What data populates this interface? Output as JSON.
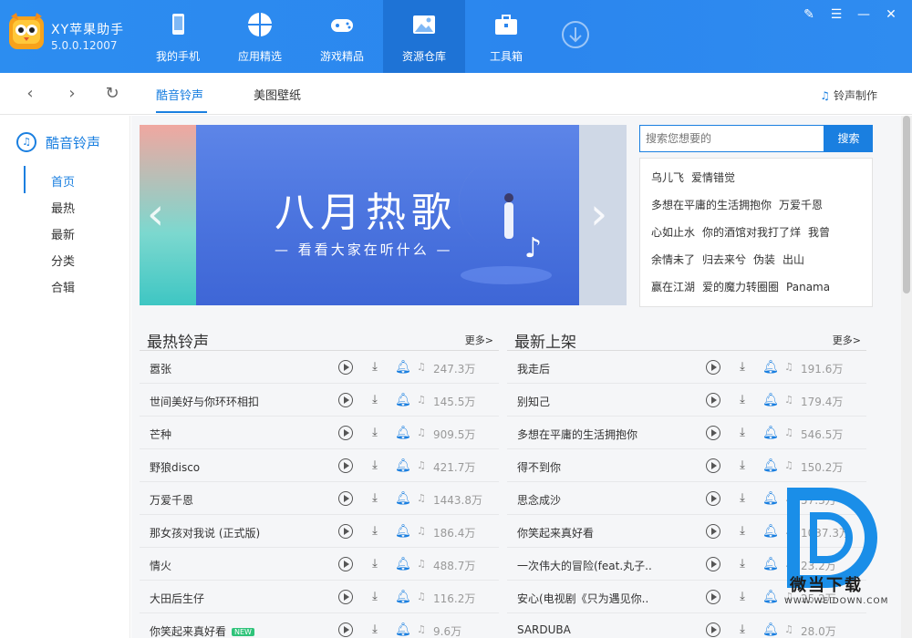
{
  "app": {
    "name": "XY苹果助手",
    "version": "5.0.0.12007"
  },
  "nav": [
    {
      "label": "我的手机",
      "icon": "phone-icon",
      "active": false
    },
    {
      "label": "应用精选",
      "icon": "apps-icon",
      "active": false
    },
    {
      "label": "游戏精品",
      "icon": "gamepad-icon",
      "active": false
    },
    {
      "label": "资源仓库",
      "icon": "image-icon",
      "active": true
    },
    {
      "label": "工具箱",
      "icon": "toolbox-icon",
      "active": false
    }
  ],
  "window_controls": [
    "skin-icon",
    "menu-icon",
    "minimize-icon",
    "close-icon"
  ],
  "subnav": {
    "tabs": [
      {
        "label": "酷音铃声",
        "active": true
      },
      {
        "label": "美图壁纸",
        "active": false
      }
    ],
    "ringtone_make": "铃声制作"
  },
  "sidebar": {
    "title": "酷音铃声",
    "items": [
      {
        "label": "首页",
        "active": true
      },
      {
        "label": "最热",
        "active": false
      },
      {
        "label": "最新",
        "active": false
      },
      {
        "label": "分类",
        "active": false
      },
      {
        "label": "合辑",
        "active": false
      }
    ]
  },
  "banner": {
    "title": "八月热歌",
    "subtitle": "— 看看大家在听什么 —"
  },
  "search": {
    "placeholder": "搜索您想要的",
    "button": "搜索"
  },
  "hot_searches": [
    [
      "乌儿飞",
      "爱情错觉"
    ],
    [
      "多想在平庸的生活拥抱你",
      "万爱千恩"
    ],
    [
      "心如止水",
      "你的酒馆对我打了烊",
      "我曾"
    ],
    [
      "余情未了",
      "归去来兮",
      "伪装",
      "出山"
    ],
    [
      "赢在江湖",
      "爱的魔力转圈圈",
      "Panama"
    ]
  ],
  "hot_list": {
    "title": "最热铃声",
    "more": "更多>",
    "rows": [
      {
        "name": "嚣张",
        "count": "247.3万"
      },
      {
        "name": "世间美好与你环环相扣",
        "count": "145.5万"
      },
      {
        "name": "芒种",
        "count": "909.5万"
      },
      {
        "name": "野狼disco",
        "count": "421.7万"
      },
      {
        "name": "万爱千恩",
        "count": "1443.8万"
      },
      {
        "name": "那女孩对我说 (正式版)",
        "count": "186.4万"
      },
      {
        "name": "情火",
        "count": "488.7万"
      },
      {
        "name": "大田后生仔",
        "count": "116.2万"
      },
      {
        "name": "你笑起来真好看",
        "count": "9.6万",
        "badge": "NEW"
      }
    ]
  },
  "new_list": {
    "title": "最新上架",
    "more": "更多>",
    "rows": [
      {
        "name": "我走后",
        "count": "191.6万"
      },
      {
        "name": "别知己",
        "count": "179.4万"
      },
      {
        "name": "多想在平庸的生活拥抱你",
        "count": "546.5万"
      },
      {
        "name": "得不到你",
        "count": "150.2万"
      },
      {
        "name": "思念成沙",
        "count": "57.3万"
      },
      {
        "name": "你笑起来真好看",
        "count": "1037.3万"
      },
      {
        "name": "一次伟大的冒险(feat.丸子..",
        "count": "23.2万"
      },
      {
        "name": "安心(电视剧《只为遇见你..",
        "count": "25.2万"
      },
      {
        "name": "SARDUBA",
        "count": "28.0万"
      }
    ]
  },
  "watermark": {
    "text": "微当下载",
    "url": "WWW.WEIDOWN.COM"
  },
  "colors": {
    "brand": "#2b86ee",
    "accent": "#1a7fe0",
    "nav_active": "#1e73d6"
  }
}
